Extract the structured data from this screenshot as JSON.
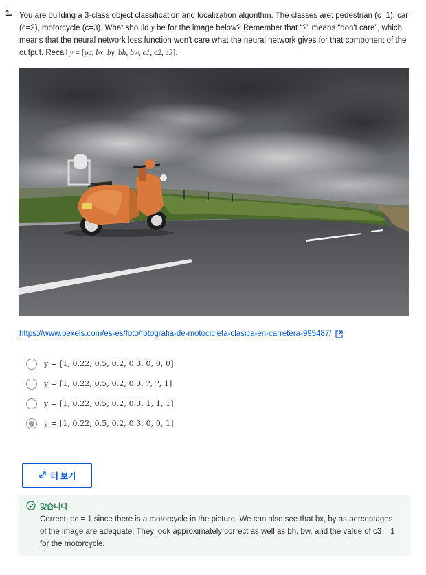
{
  "question": {
    "number": "1.",
    "text_intro": "You are building a 3-class object classification and localization algorithm. The classes are: pedestrian (c=1), car (c=2), motorcycle (c=3). What should ",
    "var_y": "y",
    "text_mid": " be for the image below? Remember that “?” means “don't care”, which means that the neural network loss function won't care what the neural network gives for that component of the output. Recall ",
    "formula": "y = [pc, bx, by, bh, bw, c1, c2, c3].",
    "formula_y": "y",
    "formula_eq": " = [",
    "formula_vars": "pc, bx, by, bh, bw, c1, c2, c3",
    "formula_end": "]."
  },
  "image": {
    "alt": "orange scooter on road",
    "link_text": "https://www.pexels.com/es-es/foto/fotografia-de-motocicleta-clasica-en-carretera-995487/",
    "link_icon": "external-link-icon"
  },
  "options": [
    {
      "label": "y = [1, 0.22, 0.5, 0.2, 0.3, 0, 0, 0]",
      "selected": false
    },
    {
      "label": "y = [1, 0.22, 0.5, 0.2, 0.3, ?, ?, 1]",
      "selected": false
    },
    {
      "label": "y = [1, 0.22, 0.5, 0.2, 0.3, 1, 1, 1]",
      "selected": false
    },
    {
      "label": "y = [1, 0.22, 0.5, 0.2, 0.3, 0, 0, 1]",
      "selected": true
    }
  ],
  "more_button": {
    "label": "더 보기",
    "icon": "expand-arrows-icon"
  },
  "feedback": {
    "status": "맞습니다",
    "icon": "check-circle-icon",
    "text": "Correct. pc = 1 since there is a motorcycle in the picture. We can also see that bx, by as percentages of the image are adequate. They look approximately correct as well as bh, bw, and the value of c3 = 1 for the motorcycle."
  },
  "colors": {
    "link": "#0056d2",
    "success": "#1e7b4b",
    "feedback_bg": "#f2f7f4"
  }
}
